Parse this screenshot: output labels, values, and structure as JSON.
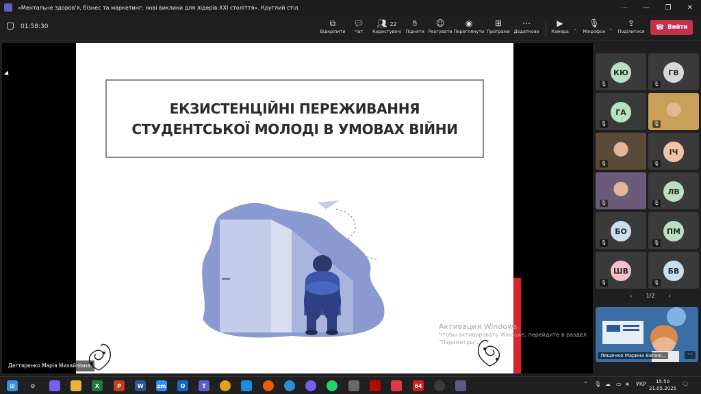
{
  "window": {
    "title": "«Ментальне здоров'я, бізнес та маркетинг: нові виклики для лідерів XXI століття». Круглий стіл.",
    "controls": [
      "⋯",
      "—",
      "❐",
      "✕"
    ]
  },
  "meeting": {
    "timer": "01:58:30",
    "toolbar": {
      "open": "Відкріпити",
      "chat": "Чат",
      "users": "Користувачі",
      "users_count": "22",
      "raise": "Підняти",
      "react": "Реагувати",
      "view": "Переглянути",
      "apps": "Програми",
      "more": "Додатково",
      "camera": "Камера",
      "mic": "Мікрофон",
      "share": "Поділитися",
      "leave": "Вийти"
    },
    "presenter_name": "Дегтяренко Марія Михайлівна"
  },
  "slide": {
    "title_line1": "ЕКЗИСТЕНЦІЙНІ ПЕРЕЖИВАННЯ",
    "title_line2": "СТУДЕНТСЬКОЇ МОЛОДІ В УМОВАХ ВІЙНИ"
  },
  "watermark": {
    "line1": "Активация Windows",
    "line2": "Чтобы активировать Windows, перейдите в раздел",
    "line3": "\"Параметры\"."
  },
  "participants": [
    {
      "initials": "КЮ",
      "color": "#b9e0c4"
    },
    {
      "initials": "ГВ",
      "color": "#d8d8d8"
    },
    {
      "initials": "ГА",
      "color": "#b9e0c4"
    },
    {
      "initials": "",
      "color": "#c9a05a"
    },
    {
      "initials": "",
      "color": "#5a4a3a"
    },
    {
      "initials": "ІЧ",
      "color": "#f3c3a8"
    },
    {
      "initials": "",
      "color": "#6b5a7a"
    },
    {
      "initials": "ЛВ",
      "color": "#b9e0c4"
    },
    {
      "initials": "БО",
      "color": "#c8dff0"
    },
    {
      "initials": "ПМ",
      "color": "#b9e0c4"
    },
    {
      "initials": "ШВ",
      "color": "#f3c0c8"
    },
    {
      "initials": "БВ",
      "color": "#c8dff0"
    }
  ],
  "pager": {
    "prev": "‹",
    "label": "1/2",
    "next": "›"
  },
  "active_speaker": {
    "name": "Лещенко Марина Євгені...",
    "more": "⋯"
  },
  "taskbar": {
    "lang": "УКР",
    "time": "15:50",
    "date": "21.05.2025"
  }
}
